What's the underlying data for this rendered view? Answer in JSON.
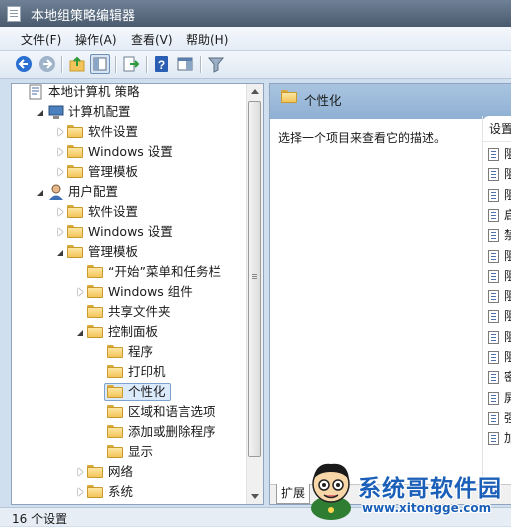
{
  "window": {
    "title": "本地组策略编辑器"
  },
  "menu": [
    {
      "label": "文件(F)"
    },
    {
      "label": "操作(A)"
    },
    {
      "label": "查看(V)"
    },
    {
      "label": "帮助(H)"
    }
  ],
  "toolbar": {
    "buttons": [
      "back-icon",
      "forward-icon",
      "up-folder-icon",
      "show-hide-tree-icon",
      "export-list-icon",
      "help-icon",
      "show-action-pane-icon",
      "filter-icon"
    ],
    "pressed": "show-hide-tree-icon"
  },
  "tree": {
    "items": [
      {
        "label": "本地计算机 策略",
        "icon": "computer-policy-icon",
        "expander": "none"
      },
      {
        "label": "计算机配置",
        "icon": "computer-config-icon",
        "expander": "open"
      },
      {
        "label": "软件设置",
        "icon": "folder-icon",
        "expander": "closed"
      },
      {
        "label": "Windows 设置",
        "icon": "folder-icon",
        "expander": "closed"
      },
      {
        "label": "管理模板",
        "icon": "folder-icon",
        "expander": "closed"
      },
      {
        "label": "用户配置",
        "icon": "user-config-icon",
        "expander": "open"
      },
      {
        "label": "软件设置",
        "icon": "folder-icon",
        "expander": "closed"
      },
      {
        "label": "Windows 设置",
        "icon": "folder-icon",
        "expander": "closed"
      },
      {
        "label": "管理模板",
        "icon": "folder-icon",
        "expander": "open"
      },
      {
        "label": "“开始”菜单和任务栏",
        "icon": "folder-icon",
        "expander": "none"
      },
      {
        "label": "Windows 组件",
        "icon": "folder-icon",
        "expander": "closed"
      },
      {
        "label": "共享文件夹",
        "icon": "folder-icon",
        "expander": "none"
      },
      {
        "label": "控制面板",
        "icon": "folder-icon",
        "expander": "open"
      },
      {
        "label": "程序",
        "icon": "folder-icon",
        "expander": "none"
      },
      {
        "label": "打印机",
        "icon": "folder-icon",
        "expander": "none"
      },
      {
        "label": "个性化",
        "icon": "folder-icon",
        "expander": "none",
        "selected": true
      },
      {
        "label": "区域和语言选项",
        "icon": "folder-icon",
        "expander": "none"
      },
      {
        "label": "添加或删除程序",
        "icon": "folder-icon",
        "expander": "none"
      },
      {
        "label": "显示",
        "icon": "folder-icon",
        "expander": "none"
      },
      {
        "label": "网络",
        "icon": "folder-icon",
        "expander": "closed"
      },
      {
        "label": "系统",
        "icon": "folder-icon",
        "expander": "closed"
      }
    ]
  },
  "right": {
    "header_title": "个性化",
    "description": "选择一个项目来查看它的描述。",
    "column_header": "设置",
    "policy_rows": [
      "阻",
      "阻",
      "阻",
      "启",
      "禁",
      "阻",
      "阻",
      "阻",
      "阻",
      "阻",
      "阻",
      "密",
      "屏",
      "强",
      "加"
    ],
    "tab_label": "扩展"
  },
  "status": {
    "text": "16 个设置"
  },
  "watermark": {
    "brand": "系统哥软件园",
    "url": "www.xitongge.com"
  }
}
